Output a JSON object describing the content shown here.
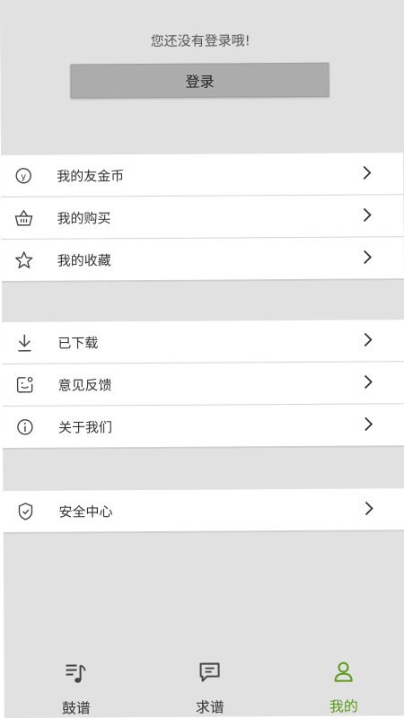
{
  "header": {
    "login_hint": "您还没有登录哦!",
    "login_button": "登录"
  },
  "group1": [
    {
      "label": "我的友金币",
      "icon": "coin-icon"
    },
    {
      "label": "我的购买",
      "icon": "basket-icon"
    },
    {
      "label": "我的收藏",
      "icon": "star-icon"
    }
  ],
  "group2": [
    {
      "label": "已下载",
      "icon": "download-icon"
    },
    {
      "label": "意见反馈",
      "icon": "feedback-icon"
    },
    {
      "label": "关于我们",
      "icon": "info-icon"
    }
  ],
  "group3": [
    {
      "label": "安全中心",
      "icon": "shield-icon"
    }
  ],
  "tabs": [
    {
      "label": "鼓谱",
      "icon": "score-icon",
      "active": false
    },
    {
      "label": "求谱",
      "icon": "message-icon",
      "active": false
    },
    {
      "label": "我的",
      "icon": "user-icon",
      "active": true
    }
  ],
  "colors": {
    "active_tab": "#5a9a18",
    "background": "#e1e1e1",
    "login_button": "#acacac"
  }
}
